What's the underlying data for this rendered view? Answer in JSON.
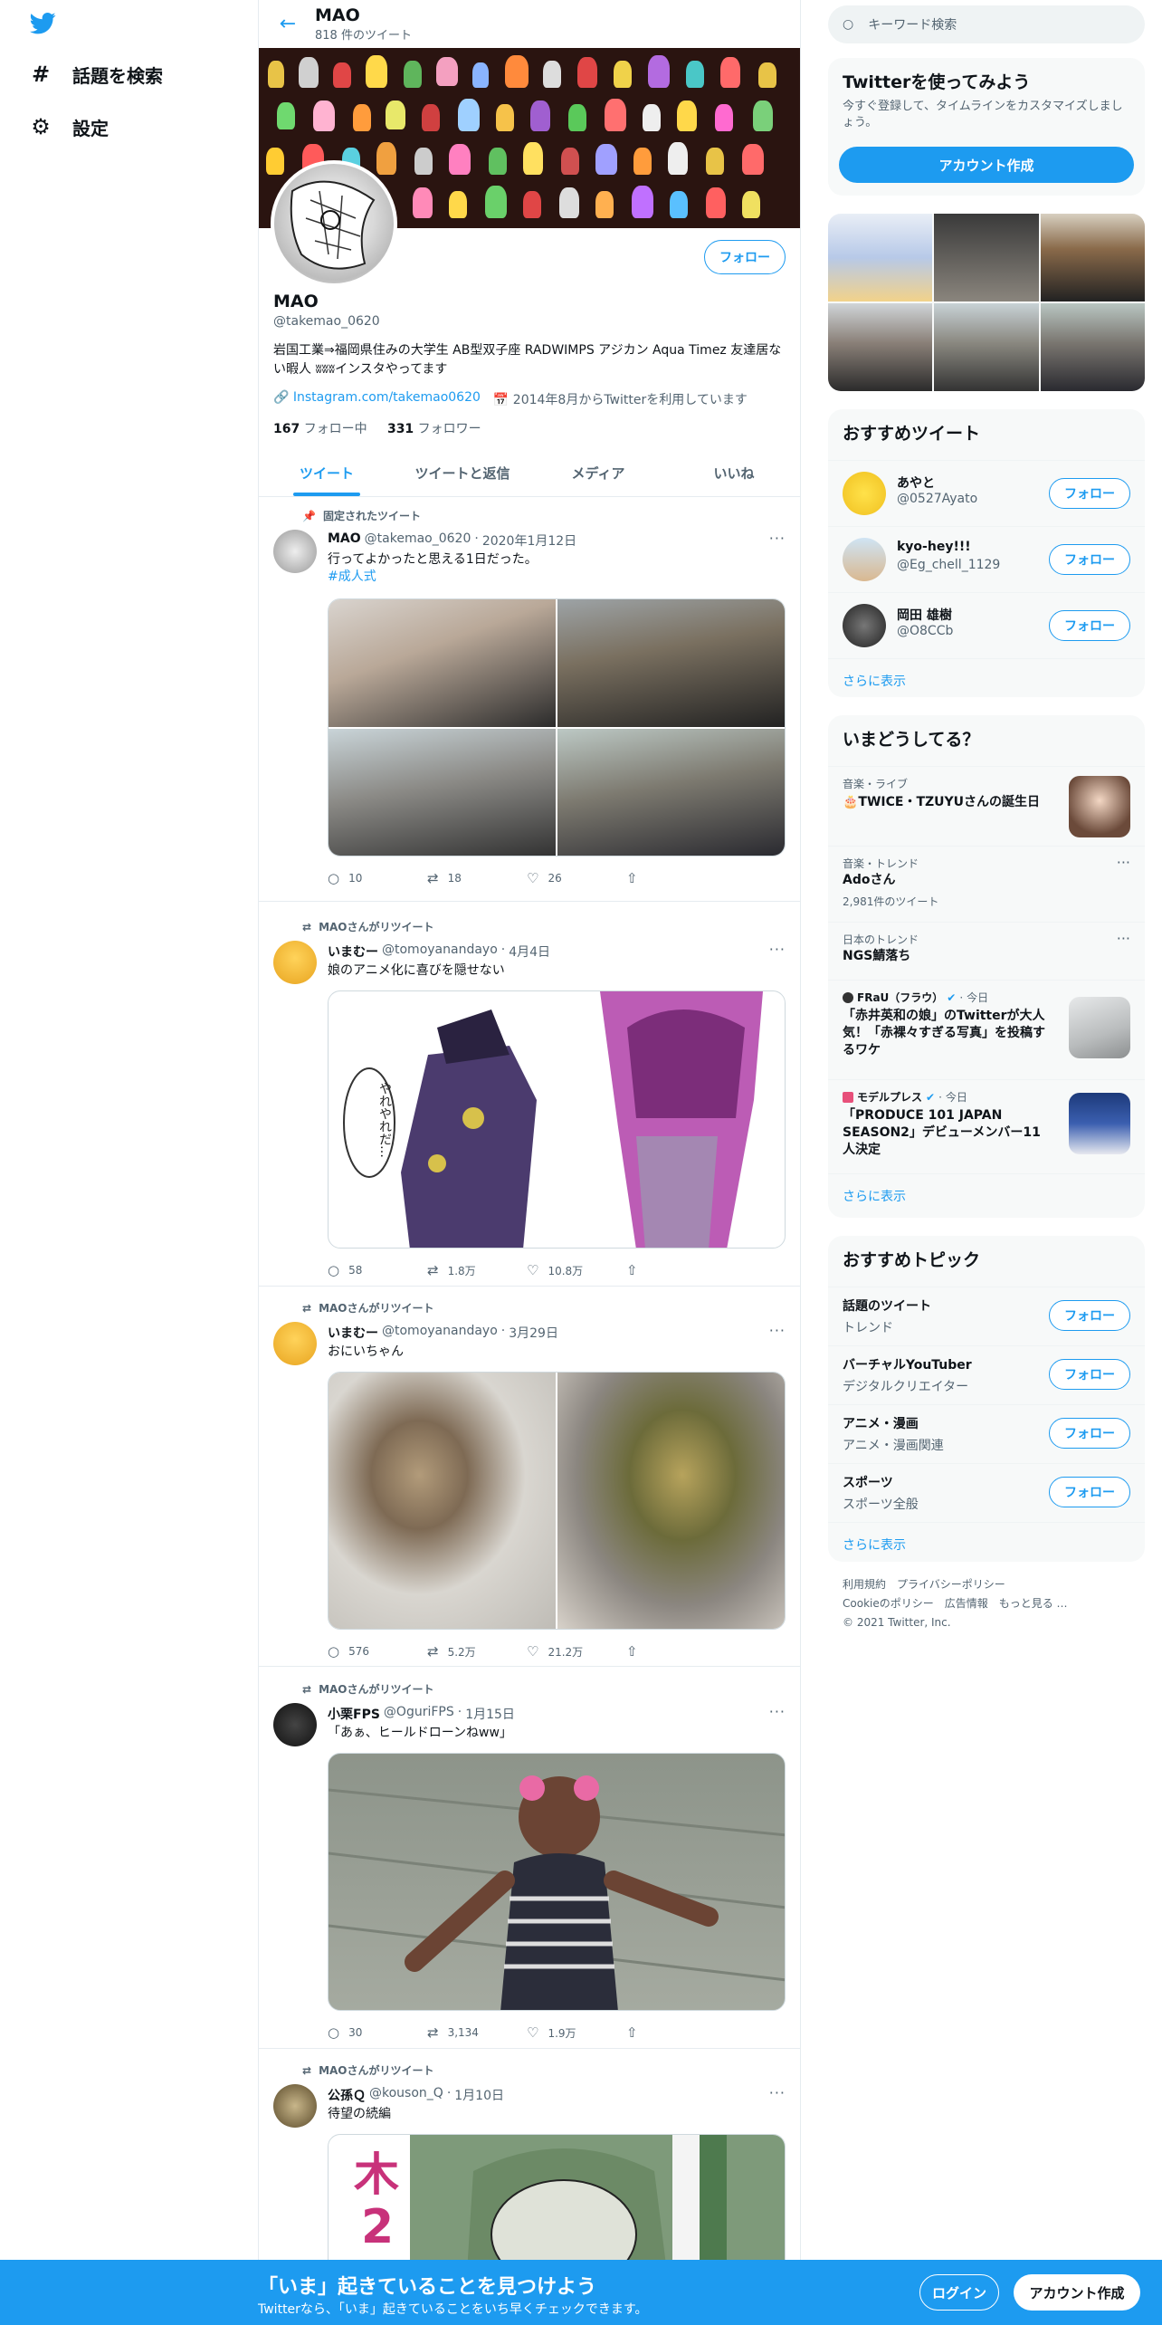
{
  "nav": {
    "explore_label": "話題を検索",
    "settings_label": "設定"
  },
  "header": {
    "name": "MAO",
    "tweet_count": "818 件のツイート"
  },
  "profile": {
    "name": "MAO",
    "handle": "@takemao_0620",
    "bio": "岩国工業⇒福岡県住みの大学生 AB型双子座 RADWIMPS アジカン Aqua Timez 友達居ない暇人 ʬʬʬインスタやってます",
    "link": "Instagram.com/takemao0620",
    "joined": "2014年8月からTwitterを利用しています",
    "following_count": "167",
    "following_label": "フォロー中",
    "followers_count": "331",
    "followers_label": "フォロワー",
    "follow_button": "フォロー"
  },
  "tabs": [
    "ツイート",
    "ツイートと返信",
    "メディア",
    "いいね"
  ],
  "tweets": [
    {
      "context": "固定されたツイート",
      "name": "MAO",
      "handle": "@takemao_0620",
      "date": "2020年1月12日",
      "text": "行ってよかったと思える1日だった。",
      "hashtag": "#成人式",
      "replies": "10",
      "retweets": "18",
      "likes": "26"
    },
    {
      "context": "MAOさんがリツイート",
      "name": "いまむー",
      "handle": "@tomoyanandayo",
      "date": "4月4日",
      "text": "娘のアニメ化に喜びを隠せない",
      "replies": "58",
      "retweets": "1.8万",
      "likes": "10.8万",
      "media_text": "やれやれだ…"
    },
    {
      "context": "MAOさんがリツイート",
      "name": "いまむー",
      "handle": "@tomoyanandayo",
      "date": "3月29日",
      "text": "おにいちゃん",
      "replies": "576",
      "retweets": "5.2万",
      "likes": "21.2万"
    },
    {
      "context": "MAOさんがリツイート",
      "name": "小栗FPS",
      "handle": "@OguriFPS",
      "date": "1月15日",
      "text": "「あぁ、ヒールドローンねww」",
      "replies": "30",
      "retweets": "3,134",
      "likes": "1.9万"
    },
    {
      "context": "MAOさんがリツイート",
      "name": "公孫Ｑ",
      "handle": "@kouson_Q",
      "date": "1月10日",
      "text": "待望の続編",
      "media_text_1": "木",
      "media_text_2": "2"
    }
  ],
  "sidebar": {
    "search_placeholder": "キーワード検索",
    "signup": {
      "title": "Twitterを使ってみよう",
      "desc": "今すぐ登録して、タイムラインをカスタマイズしましょう。",
      "button": "アカウント作成"
    },
    "recommended": {
      "title": "おすすめツイート",
      "users": [
        {
          "name": "あやと",
          "handle": "@0527Ayato"
        },
        {
          "name": "kyo-hey!!!",
          "handle": "@Eg_chell_1129"
        },
        {
          "name": "岡田 雄樹",
          "handle": "@O8CCb"
        }
      ],
      "follow": "フォロー",
      "more": "さらに表示"
    },
    "trends": {
      "title": "いまどうしてる？",
      "items": [
        {
          "cat": "音楽・ライブ",
          "title": "🎂TWICE・TZUYUさんの誕生日"
        },
        {
          "cat": "音楽・トレンド",
          "title": "Adoさん",
          "sub": "2,981件のツイート"
        },
        {
          "cat": "日本のトレンド",
          "title": "NGS鯖落ち"
        },
        {
          "source": "FRaU（フラウ）",
          "date": "今日",
          "title": "「赤井英和の娘」のTwitterが大人気！「赤裸々すぎる写真」を投稿するワケ"
        },
        {
          "source": "モデルプレス",
          "date": "今日",
          "title": "「PRODUCE 101 JAPAN SEASON2」デビューメンバー11人決定"
        }
      ],
      "more": "さらに表示"
    },
    "topics": {
      "title": "おすすめトピック",
      "items": [
        {
          "title": "話題のツイート",
          "sub": "トレンド"
        },
        {
          "title": "バーチャルYouTuber",
          "sub": "デジタルクリエイター"
        },
        {
          "title": "アニメ・漫画",
          "sub": "アニメ・漫画関連"
        },
        {
          "title": "スポーツ",
          "sub": "スポーツ全般"
        }
      ],
      "follow": "フォロー",
      "more": "さらに表示"
    },
    "footer": {
      "line1": "利用規約　プライバシーポリシー",
      "line2": "Cookieのポリシー　広告情報　もっと見る …",
      "line3": "© 2021 Twitter, Inc."
    }
  },
  "bottom": {
    "title": "「いま」起きていることを見つけよう",
    "sub": "Twitterなら、「いま」起きていることをいち早くチェックできます。",
    "login": "ログイン",
    "signup": "アカウント作成"
  },
  "colors": {
    "accent": "#1d9bf0"
  }
}
